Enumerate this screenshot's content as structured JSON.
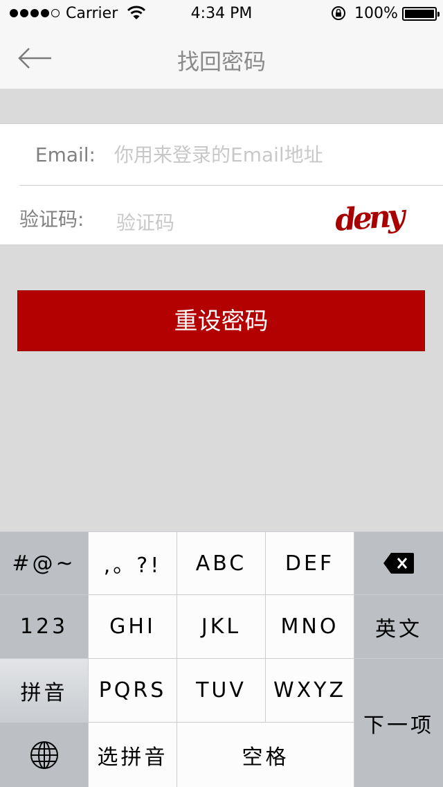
{
  "status_bar": {
    "carrier": "Carrier",
    "time": "4:34 PM",
    "battery": "100%",
    "signal_icon": "signal-dots-icon",
    "wifi_icon": "wifi-icon",
    "lock_icon": "rotation-lock-icon",
    "battery_icon": "battery-icon"
  },
  "navbar": {
    "title": "找回密码",
    "back_icon": "back-arrow-icon"
  },
  "form": {
    "email_label": "Email:",
    "email_placeholder": "你用来登录的Email地址",
    "email_value": "",
    "code_label": "验证码:",
    "code_placeholder": "验证码",
    "code_value": "",
    "captcha_text": "deny"
  },
  "actions": {
    "reset_label": "重设密码"
  },
  "keyboard": {
    "symbols": "#@~",
    "punct": ",。?!",
    "abc": "ABC",
    "def": "DEF",
    "delete_icon": "backspace-icon",
    "num": "123",
    "ghi": "GHI",
    "jkl": "JKL",
    "mno": "MNO",
    "english": "英文",
    "pinyin": "拼音",
    "pqrs": "PQRS",
    "tuv": "TUV",
    "wxyz": "WXYZ",
    "next": "下一项",
    "globe_icon": "globe-icon",
    "select_pinyin": "选拼音",
    "space": "空格"
  },
  "colors": {
    "accent": "#b30000",
    "captcha": "#a80000"
  }
}
